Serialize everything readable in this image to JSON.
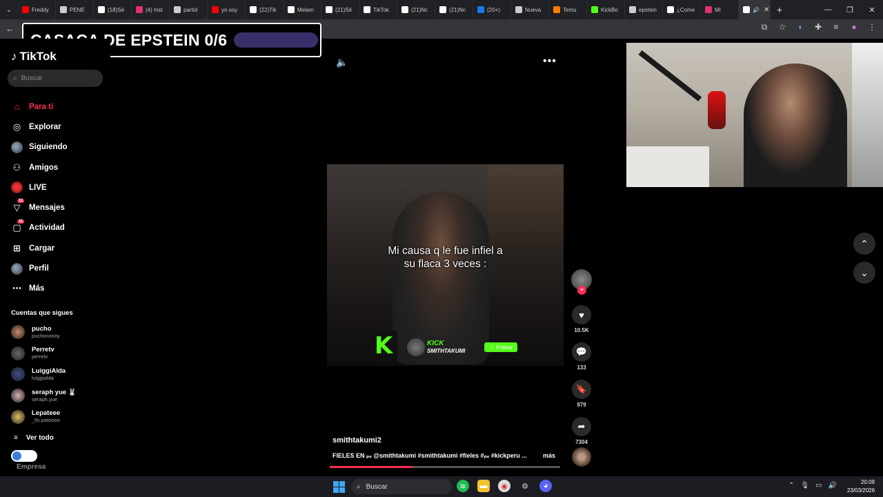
{
  "browser": {
    "tabs": [
      {
        "label": "Freddy",
        "color": "#ff0000"
      },
      {
        "label": "PENE",
        "color": "#cccccc"
      },
      {
        "label": "(18)Sé",
        "color": "#ffffff"
      },
      {
        "label": "(4) Inst",
        "color": "#e1306c"
      },
      {
        "label": "partid",
        "color": "#cccccc"
      },
      {
        "label": "yo soy",
        "color": "#ff0000"
      },
      {
        "label": "(22)Tik",
        "color": "#ffffff"
      },
      {
        "label": "Melam",
        "color": "#ffffff"
      },
      {
        "label": "(21)Sé",
        "color": "#ffffff"
      },
      {
        "label": "TikTok",
        "color": "#ffffff"
      },
      {
        "label": "(21)Nc",
        "color": "#ffffff"
      },
      {
        "label": "(21)Nc",
        "color": "#ffffff"
      },
      {
        "label": "(20+)",
        "color": "#1877f2"
      },
      {
        "label": "Nueva",
        "color": "#cccccc"
      },
      {
        "label": "Temu",
        "color": "#ff7a00"
      },
      {
        "label": "KickBo",
        "color": "#53fc18"
      },
      {
        "label": "epstein",
        "color": "#cccccc"
      },
      {
        "label": "¿Come",
        "color": "#ffffff"
      },
      {
        "label": "MI",
        "color": "#e1306c"
      }
    ]
  },
  "overlay": {
    "title": "CASACA DE EPSTEIN 0/6"
  },
  "sidebar": {
    "logo": "TikTok",
    "search_placeholder": "Buscar",
    "nav": [
      {
        "label": "Para ti",
        "icon": "home-icon"
      },
      {
        "label": "Explorar",
        "icon": "compass-icon"
      },
      {
        "label": "Siguiendo",
        "icon": "following-icon"
      },
      {
        "label": "Amigos",
        "icon": "friends-icon"
      },
      {
        "label": "LIVE",
        "icon": "live-icon"
      },
      {
        "label": "Mensajes",
        "icon": "messages-icon",
        "badge": "11"
      },
      {
        "label": "Actividad",
        "icon": "activity-icon",
        "badge": "11"
      },
      {
        "label": "Cargar",
        "icon": "upload-icon"
      },
      {
        "label": "Perfil",
        "icon": "profile-icon"
      },
      {
        "label": "Más",
        "icon": "more-icon"
      }
    ],
    "following_header": "Cuentas que sigues",
    "following": [
      {
        "name": "pucho",
        "handle": "puchonosoy",
        "color": "#c98a6a"
      },
      {
        "name": "Perretv",
        "handle": "perretv",
        "color": "#666666"
      },
      {
        "name": "LuiggiAlda",
        "handle": "luiggialda",
        "color": "#3a4a8a"
      },
      {
        "name": "seraph yue 🐰",
        "handle": "seraph.yue",
        "color": "#d8b0b0"
      },
      {
        "name": "Lepateee",
        "handle": "_lts.patoooo",
        "color": "#e0c060"
      }
    ],
    "see_all": "Ver todo",
    "business": "Empresa"
  },
  "video": {
    "caption_line1": "Mi causa q le fue infiel a",
    "caption_line2": "su flaca 3 veces :",
    "kick_label": "KICK",
    "kick_user": "SMITHTAKUMI",
    "follow_label": "Follow",
    "author": "smithtakumi2",
    "description": "FIELES EN ₚₑ @smithtakumi #smithtakumi #fieles #ₚₑ #kickperu ...",
    "more": "más",
    "progress": 0.36,
    "likes": "10.5K",
    "comments": "133",
    "saves": "979",
    "shares": "7304"
  },
  "taskbar": {
    "search": "Buscar",
    "time": "20:09",
    "date": "23/03/2026"
  }
}
